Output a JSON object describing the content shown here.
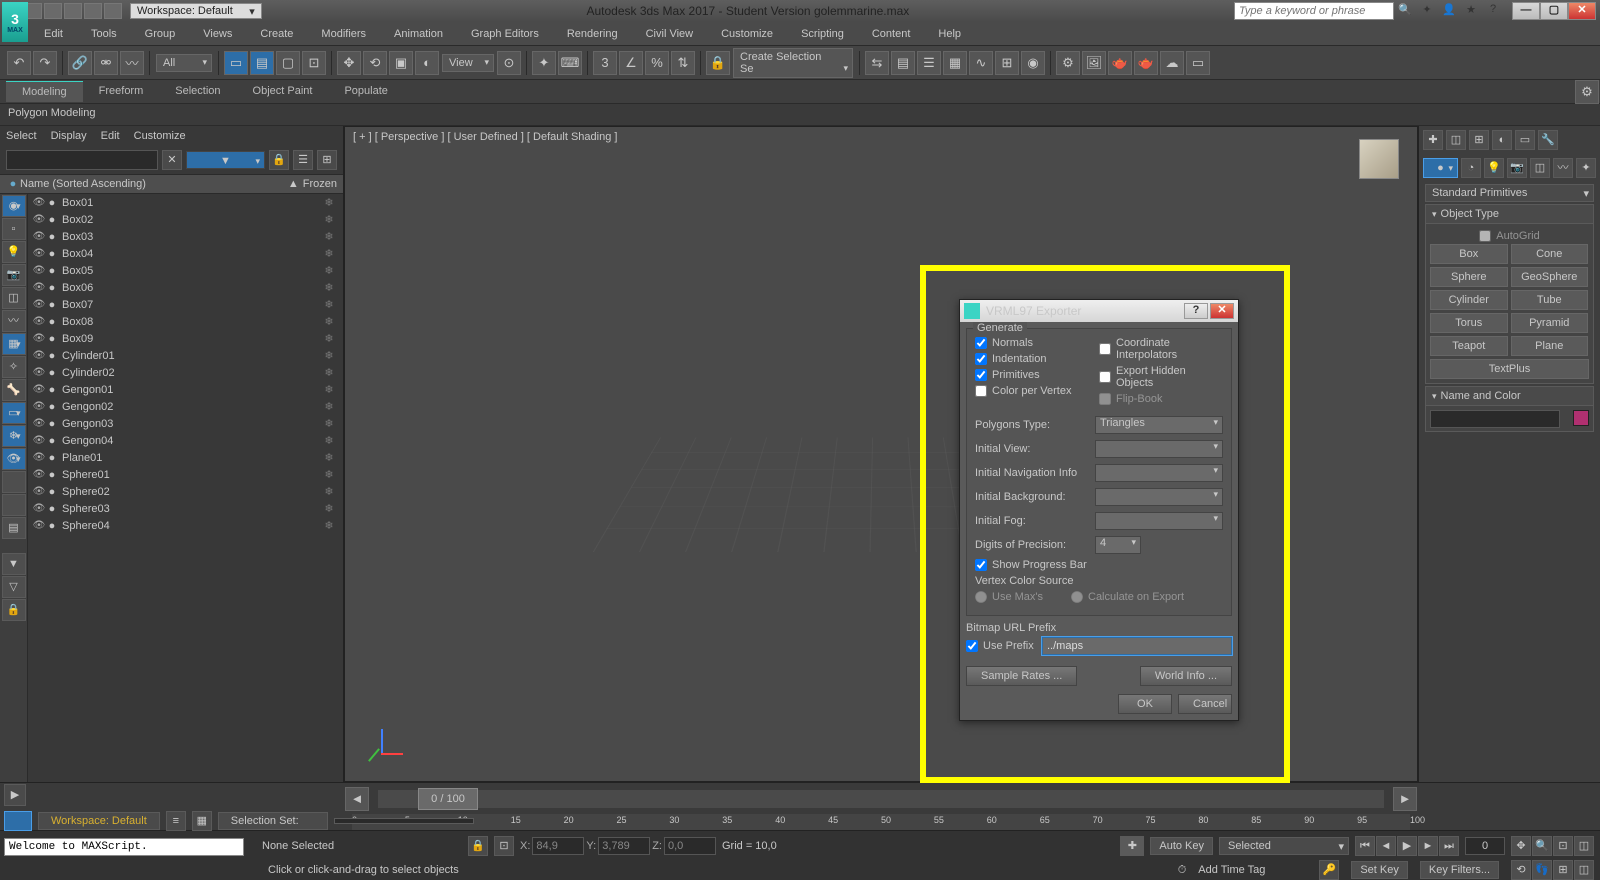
{
  "titlebar": {
    "workspace": "Workspace: Default",
    "title": "Autodesk 3ds Max 2017 - Student Version     golemmarine.max",
    "search_placeholder": "Type a keyword or phrase"
  },
  "menu": [
    "Edit",
    "Tools",
    "Group",
    "Views",
    "Create",
    "Modifiers",
    "Animation",
    "Graph Editors",
    "Rendering",
    "Civil View",
    "Customize",
    "Scripting",
    "Content",
    "Help"
  ],
  "toolbar": {
    "filter": "All",
    "view": "View",
    "selset": "Create Selection Se"
  },
  "ribbon": {
    "tabs": [
      "Modeling",
      "Freeform",
      "Selection",
      "Object Paint",
      "Populate"
    ],
    "sub": "Polygon Modeling"
  },
  "scene": {
    "menu": [
      "Select",
      "Display",
      "Edit",
      "Customize"
    ],
    "col_name": "Name (Sorted Ascending)",
    "col_frozen": "Frozen",
    "items": [
      "Box01",
      "Box02",
      "Box03",
      "Box04",
      "Box05",
      "Box06",
      "Box07",
      "Box08",
      "Box09",
      "Cylinder01",
      "Cylinder02",
      "Gengon01",
      "Gengon02",
      "Gengon03",
      "Gengon04",
      "Plane01",
      "Sphere01",
      "Sphere02",
      "Sphere03",
      "Sphere04"
    ]
  },
  "viewport": {
    "label": "[ + ] [ Perspective ] [ User Defined ] [ Default Shading ]"
  },
  "modal": {
    "title": "VRML97 Exporter",
    "g_generate": "Generate",
    "chk_normals": "Normals",
    "chk_indent": "Indentation",
    "chk_prims": "Primitives",
    "chk_cpv": "Color per Vertex",
    "chk_coord": "Coordinate Interpolators",
    "chk_hidden": "Export Hidden Objects",
    "chk_flip": "Flip-Book",
    "l_poly": "Polygons Type:",
    "v_poly": "Triangles",
    "l_view": "Initial View:",
    "l_nav": "Initial Navigation Info",
    "l_bg": "Initial Background:",
    "l_fog": "Initial Fog:",
    "l_digits": "Digits of Precision:",
    "v_digits": "4",
    "chk_progress": "Show Progress Bar",
    "g_vcs": "Vertex Color Source",
    "r_usemax": "Use Max's",
    "r_calc": "Calculate on Export",
    "g_bitmap": "Bitmap URL Prefix",
    "chk_prefix": "Use Prefix",
    "v_prefix": "../maps",
    "b_sample": "Sample Rates ...",
    "b_world": "World Info ...",
    "b_ok": "OK",
    "b_cancel": "Cancel"
  },
  "cmdpanel": {
    "dd": "Standard Primitives",
    "r_objtype": "Object Type",
    "autogrid": "AutoGrid",
    "prims": [
      "Box",
      "Cone",
      "Sphere",
      "GeoSphere",
      "Cylinder",
      "Tube",
      "Torus",
      "Pyramid",
      "Teapot",
      "Plane",
      "TextPlus"
    ],
    "r_name": "Name and Color"
  },
  "status": {
    "workspace": "Workspace: Default",
    "selset_label": "Selection Set:",
    "none": "None Selected",
    "hint": "Click or click-and-drag to select objects",
    "x": "84,9",
    "y": "3,789",
    "z": "0,0",
    "grid": "Grid = 10,0",
    "addtag": "Add Time Tag",
    "autokey": "Auto Key",
    "selected": "Selected",
    "setkey": "Set Key",
    "keyfilters": "Key Filters...",
    "frame": "0",
    "slider": "0 / 100",
    "maxscript": "Welcome to MAXScript."
  },
  "ruler": [
    0,
    5,
    10,
    15,
    20,
    25,
    30,
    35,
    40,
    45,
    50,
    55,
    60,
    65,
    70,
    75,
    80,
    85,
    90,
    95,
    100
  ]
}
